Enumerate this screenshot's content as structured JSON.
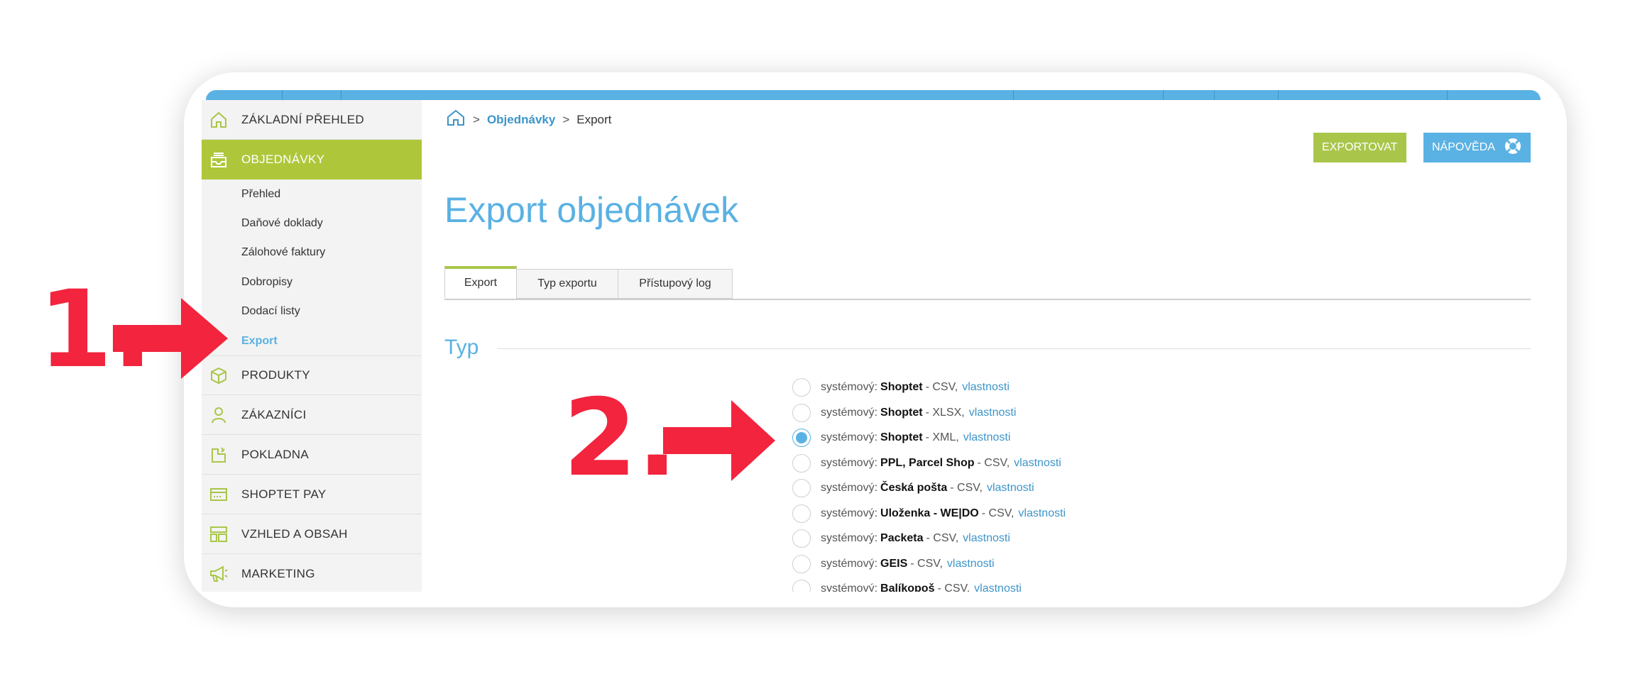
{
  "annotations": {
    "step1": "1.",
    "step2": "2."
  },
  "breadcrumb": {
    "middle": "Objednávky",
    "current": "Export",
    "separator": ">"
  },
  "buttons": {
    "export": "EXPORTOVAT",
    "help": "NÁPOVĚDA"
  },
  "sidebar": {
    "items": [
      {
        "label": "ZÁKLADNÍ PŘEHLED",
        "icon": "home-icon"
      },
      {
        "label": "OBJEDNÁVKY",
        "icon": "inbox-icon",
        "active": true
      },
      {
        "label": "PRODUKTY",
        "icon": "box-icon"
      },
      {
        "label": "ZÁKAZNÍCI",
        "icon": "user-icon"
      },
      {
        "label": "POKLADNA",
        "icon": "cash-register-icon"
      },
      {
        "label": "SHOPTET PAY",
        "icon": "card-icon"
      },
      {
        "label": "VZHLED A OBSAH",
        "icon": "layout-icon"
      },
      {
        "label": "MARKETING",
        "icon": "megaphone-icon"
      }
    ],
    "subitems": [
      "Přehled",
      "Daňové doklady",
      "Zálohové faktury",
      "Dobropisy",
      "Dodací listy",
      "Export"
    ]
  },
  "page": {
    "title": "Export objednávek",
    "section": "Typ"
  },
  "tabs": [
    "Export",
    "Typ exportu",
    "Přístupový log"
  ],
  "options": [
    {
      "prefix": "systémový:",
      "name": "Shoptet",
      "format": "- CSV,",
      "link": "vlastnosti"
    },
    {
      "prefix": "systémový:",
      "name": "Shoptet",
      "format": "- XLSX,",
      "link": "vlastnosti"
    },
    {
      "prefix": "systémový:",
      "name": "Shoptet",
      "format": "- XML,",
      "link": "vlastnosti",
      "selected": true
    },
    {
      "prefix": "systémový:",
      "name": "PPL, Parcel Shop",
      "format": "- CSV,",
      "link": "vlastnosti"
    },
    {
      "prefix": "systémový:",
      "name": "Česká pošta",
      "format": "- CSV,",
      "link": "vlastnosti"
    },
    {
      "prefix": "systémový:",
      "name": "Uloženka - WE|DO",
      "format": "- CSV,",
      "link": "vlastnosti"
    },
    {
      "prefix": "systémový:",
      "name": "Packeta",
      "format": "- CSV,",
      "link": "vlastnosti"
    },
    {
      "prefix": "systémový:",
      "name": "GEIS",
      "format": "- CSV,",
      "link": "vlastnosti"
    },
    {
      "prefix": "systémový:",
      "name": "Balíkopoš",
      "format": "- CSV,",
      "link": "vlastnosti"
    }
  ],
  "colors": {
    "accent_green": "#aec73a",
    "accent_blue": "#5ab1e3",
    "annotation_red": "#f2243e"
  }
}
